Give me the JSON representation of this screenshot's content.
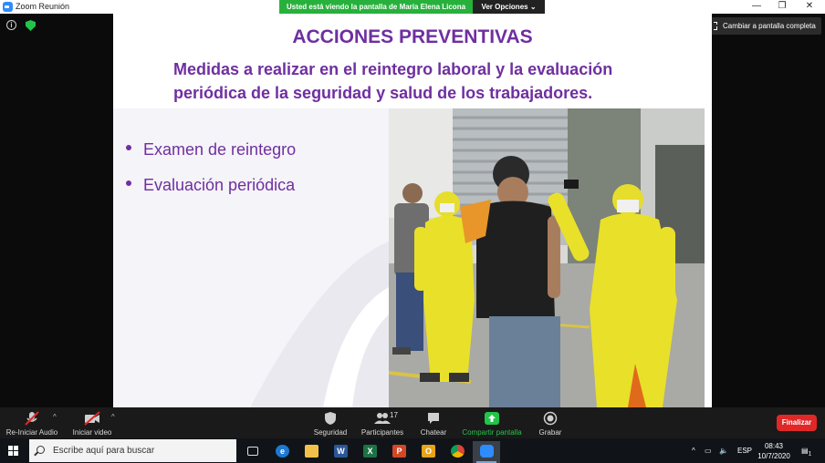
{
  "window": {
    "title": "Zoom Reunión",
    "share_banner": "Usted está viendo la pantalla de María Elena Licona",
    "view_options": "Ver Opciones",
    "fullscreen_label": "Cambiar a pantalla completa"
  },
  "slide": {
    "title": "ACCIONES PREVENTIVAS",
    "subtitle_line1": "Medidas a realizar en el reintegro laboral y la evaluación",
    "subtitle_line2": "periódica de la seguridad y salud de los trabajadores.",
    "bullets": [
      "Examen de  reintegro",
      "Evaluación periódica"
    ],
    "colors": {
      "accent": "#6f2fa0",
      "suit": "#e9e02a"
    }
  },
  "controls": {
    "audio": "Re-Iniciar Audio",
    "video": "Iniciar video",
    "security": "Seguridad",
    "participants": "Participantes",
    "participants_count": "17",
    "chat": "Chatear",
    "share": "Compartir pantalla",
    "record": "Grabar",
    "end": "Finalizar",
    "colors": {
      "share_green": "#23c44a",
      "end_red": "#e02828"
    }
  },
  "taskbar": {
    "search_placeholder": "Escribe aquí para buscar",
    "language": "ESP",
    "time": "08:43",
    "date": "10/7/2020",
    "notification_count": "1",
    "apps": [
      "task-view",
      "edge",
      "file-explorer",
      "word",
      "excel",
      "powerpoint",
      "outlook",
      "chrome",
      "zoom"
    ]
  }
}
